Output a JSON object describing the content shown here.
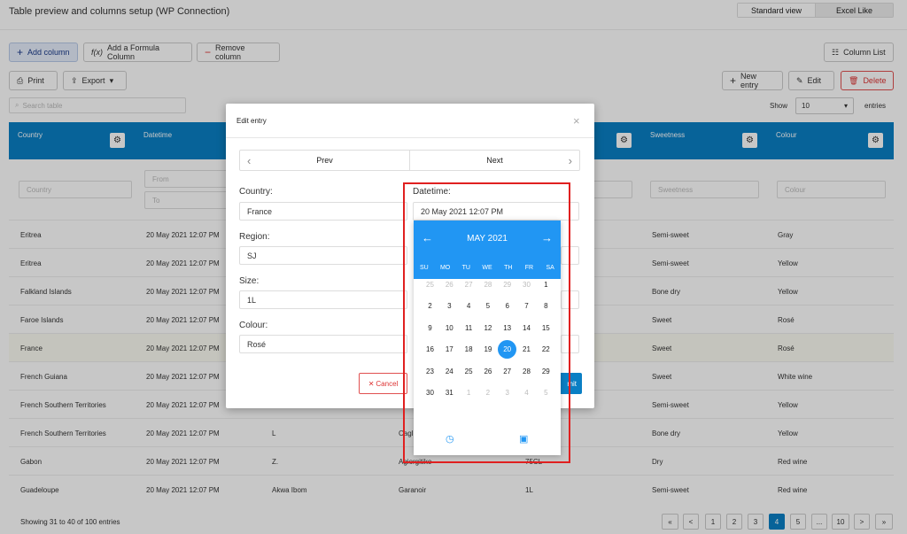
{
  "page": {
    "title": "Table preview and columns setup (WP Connection)",
    "view_standard": "Standard view",
    "view_excel": "Excel Like"
  },
  "toolbar": {
    "add_column": "Add column",
    "add_formula": "Add a Formula Column",
    "remove_column": "Remove column",
    "column_list": "Column List",
    "print": "Print",
    "export": "Export",
    "new_entry": "New entry",
    "edit": "Edit",
    "delete": "Delete"
  },
  "table": {
    "search_placeholder": "Search table",
    "show_label": "Show",
    "show_value": "10",
    "entries_label": "entries",
    "headers": [
      "Country",
      "Datetime",
      "Sweetness",
      "Colour"
    ],
    "filters": {
      "country": "Country",
      "from": "From",
      "to": "To",
      "sweetness": "Sweetness",
      "colour": "Colour"
    },
    "rows": [
      {
        "country": "Eritrea",
        "datetime": "20 May 2021 12:07 PM",
        "region": "",
        "grape": "",
        "size": "",
        "sweetness": "Semi-sweet",
        "colour": "Gray"
      },
      {
        "country": "Eritrea",
        "datetime": "20 May 2021 12:07 PM",
        "region": "",
        "grape": "",
        "size": "",
        "sweetness": "Semi-sweet",
        "colour": "Yellow"
      },
      {
        "country": "Falkland Islands",
        "datetime": "20 May 2021 12:07 PM",
        "region": "",
        "grape": "",
        "size": "",
        "sweetness": "Bone dry",
        "colour": "Yellow"
      },
      {
        "country": "Faroe Islands",
        "datetime": "20 May 2021 12:07 PM",
        "region": "",
        "grape": "",
        "size": "",
        "sweetness": "Sweet",
        "colour": "Rosé"
      },
      {
        "country": "France",
        "datetime": "20 May 2021 12:07 PM",
        "region": "",
        "grape": "",
        "size": "",
        "sweetness": "Sweet",
        "colour": "Rosé"
      },
      {
        "country": "French Guiana",
        "datetime": "20 May 2021 12:07 PM",
        "region": "",
        "grape": "",
        "size": "",
        "sweetness": "Sweet",
        "colour": "White wine"
      },
      {
        "country": "French Southern Territories",
        "datetime": "20 May 2021 12:07 PM",
        "region": "",
        "grape": "",
        "size": "",
        "sweetness": "Semi-sweet",
        "colour": "Yellow"
      },
      {
        "country": "French Southern Territories",
        "datetime": "20 May 2021 12:07 PM",
        "region": "L",
        "grape": "Cagli",
        "size": "",
        "sweetness": "Bone dry",
        "colour": "Yellow"
      },
      {
        "country": "Gabon",
        "datetime": "20 May 2021 12:07 PM",
        "region": "Z.",
        "grape": "Agiorgitiko",
        "size": "75CL",
        "sweetness": "Dry",
        "colour": "Red wine"
      },
      {
        "country": "Guadeloupe",
        "datetime": "20 May 2021 12:07 PM",
        "region": "Akwa Ibom",
        "grape": "Garanoir",
        "size": "1L",
        "sweetness": "Semi-sweet",
        "colour": "Red wine"
      }
    ],
    "footer": "Showing 31 to 40 of 100 entries",
    "pages": [
      "«",
      "<",
      "1",
      "2",
      "3",
      "4",
      "5",
      "...",
      "10",
      ">",
      "»"
    ]
  },
  "modal": {
    "title": "Edit entry",
    "close": "×",
    "prev": "Prev",
    "next": "Next",
    "country_label": "Country:",
    "country_value": "France",
    "region_label": "Region:",
    "region_value": "SJ",
    "size_label": "Size:",
    "size_value": "1L",
    "colour_label": "Colour:",
    "colour_value": "Rosé",
    "datetime_label": "Datetime:",
    "datetime_value": "20 May 2021 12:07 PM",
    "cancel": "Cancel",
    "submit": "mit"
  },
  "datepicker": {
    "month": "MAY 2021",
    "prev_arrow": "←",
    "next_arrow": "→",
    "weekdays": [
      "SU",
      "MO",
      "TU",
      "WE",
      "TH",
      "FR",
      "SA"
    ],
    "weeks": [
      [
        "25",
        "26",
        "27",
        "28",
        "29",
        "30",
        "1"
      ],
      [
        "2",
        "3",
        "4",
        "5",
        "6",
        "7",
        "8"
      ],
      [
        "9",
        "10",
        "11",
        "12",
        "13",
        "14",
        "15"
      ],
      [
        "16",
        "17",
        "18",
        "19",
        "20",
        "21",
        "22"
      ],
      [
        "23",
        "24",
        "25",
        "26",
        "27",
        "28",
        "29"
      ],
      [
        "30",
        "31",
        "1",
        "2",
        "3",
        "4",
        "5"
      ]
    ],
    "selected": "20"
  },
  "colors": {
    "primary": "#0a7fc4",
    "picker": "#2196f3",
    "highlight": "#e02020"
  }
}
